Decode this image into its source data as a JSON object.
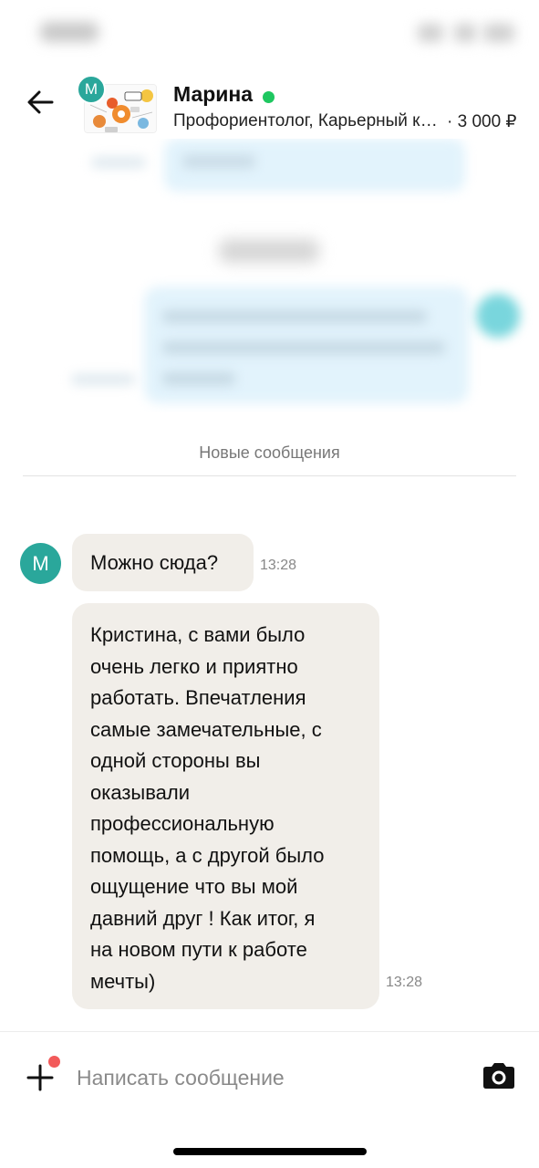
{
  "header": {
    "back_icon": "arrow-left-icon",
    "avatar_letter": "M",
    "name": "Марина",
    "online_color": "#1ec760",
    "subtitle": "Профориентолог, Карьерный консультант",
    "price": "· 3 000 ₽"
  },
  "divider": {
    "label": "Новые сообщения"
  },
  "messages": [
    {
      "sender_avatar_letter": "M",
      "text": "Можно сюда?",
      "time": "13:28"
    },
    {
      "text_lines": [
        "Кристина, с вами было",
        "очень легко и приятно",
        "работать. Впечатления",
        "самые замечательные, с",
        "одной стороны вы",
        "оказывали",
        "профессиональную",
        "помощь, а с другой было",
        "ощущение что вы мой",
        "давний друг ! Как итог, я",
        "на новом пути к работе",
        "мечты)"
      ],
      "time": "13:28"
    }
  ],
  "input_bar": {
    "placeholder": "Написать сообщение",
    "plus_icon": "plus-icon",
    "camera_icon": "camera-icon",
    "badge_color": "#f25a5a"
  },
  "colors": {
    "avatar": "#2aa79b",
    "bubble_incoming": "#f1eee9",
    "bubble_outgoing_blurred": "#e2f3fc"
  }
}
